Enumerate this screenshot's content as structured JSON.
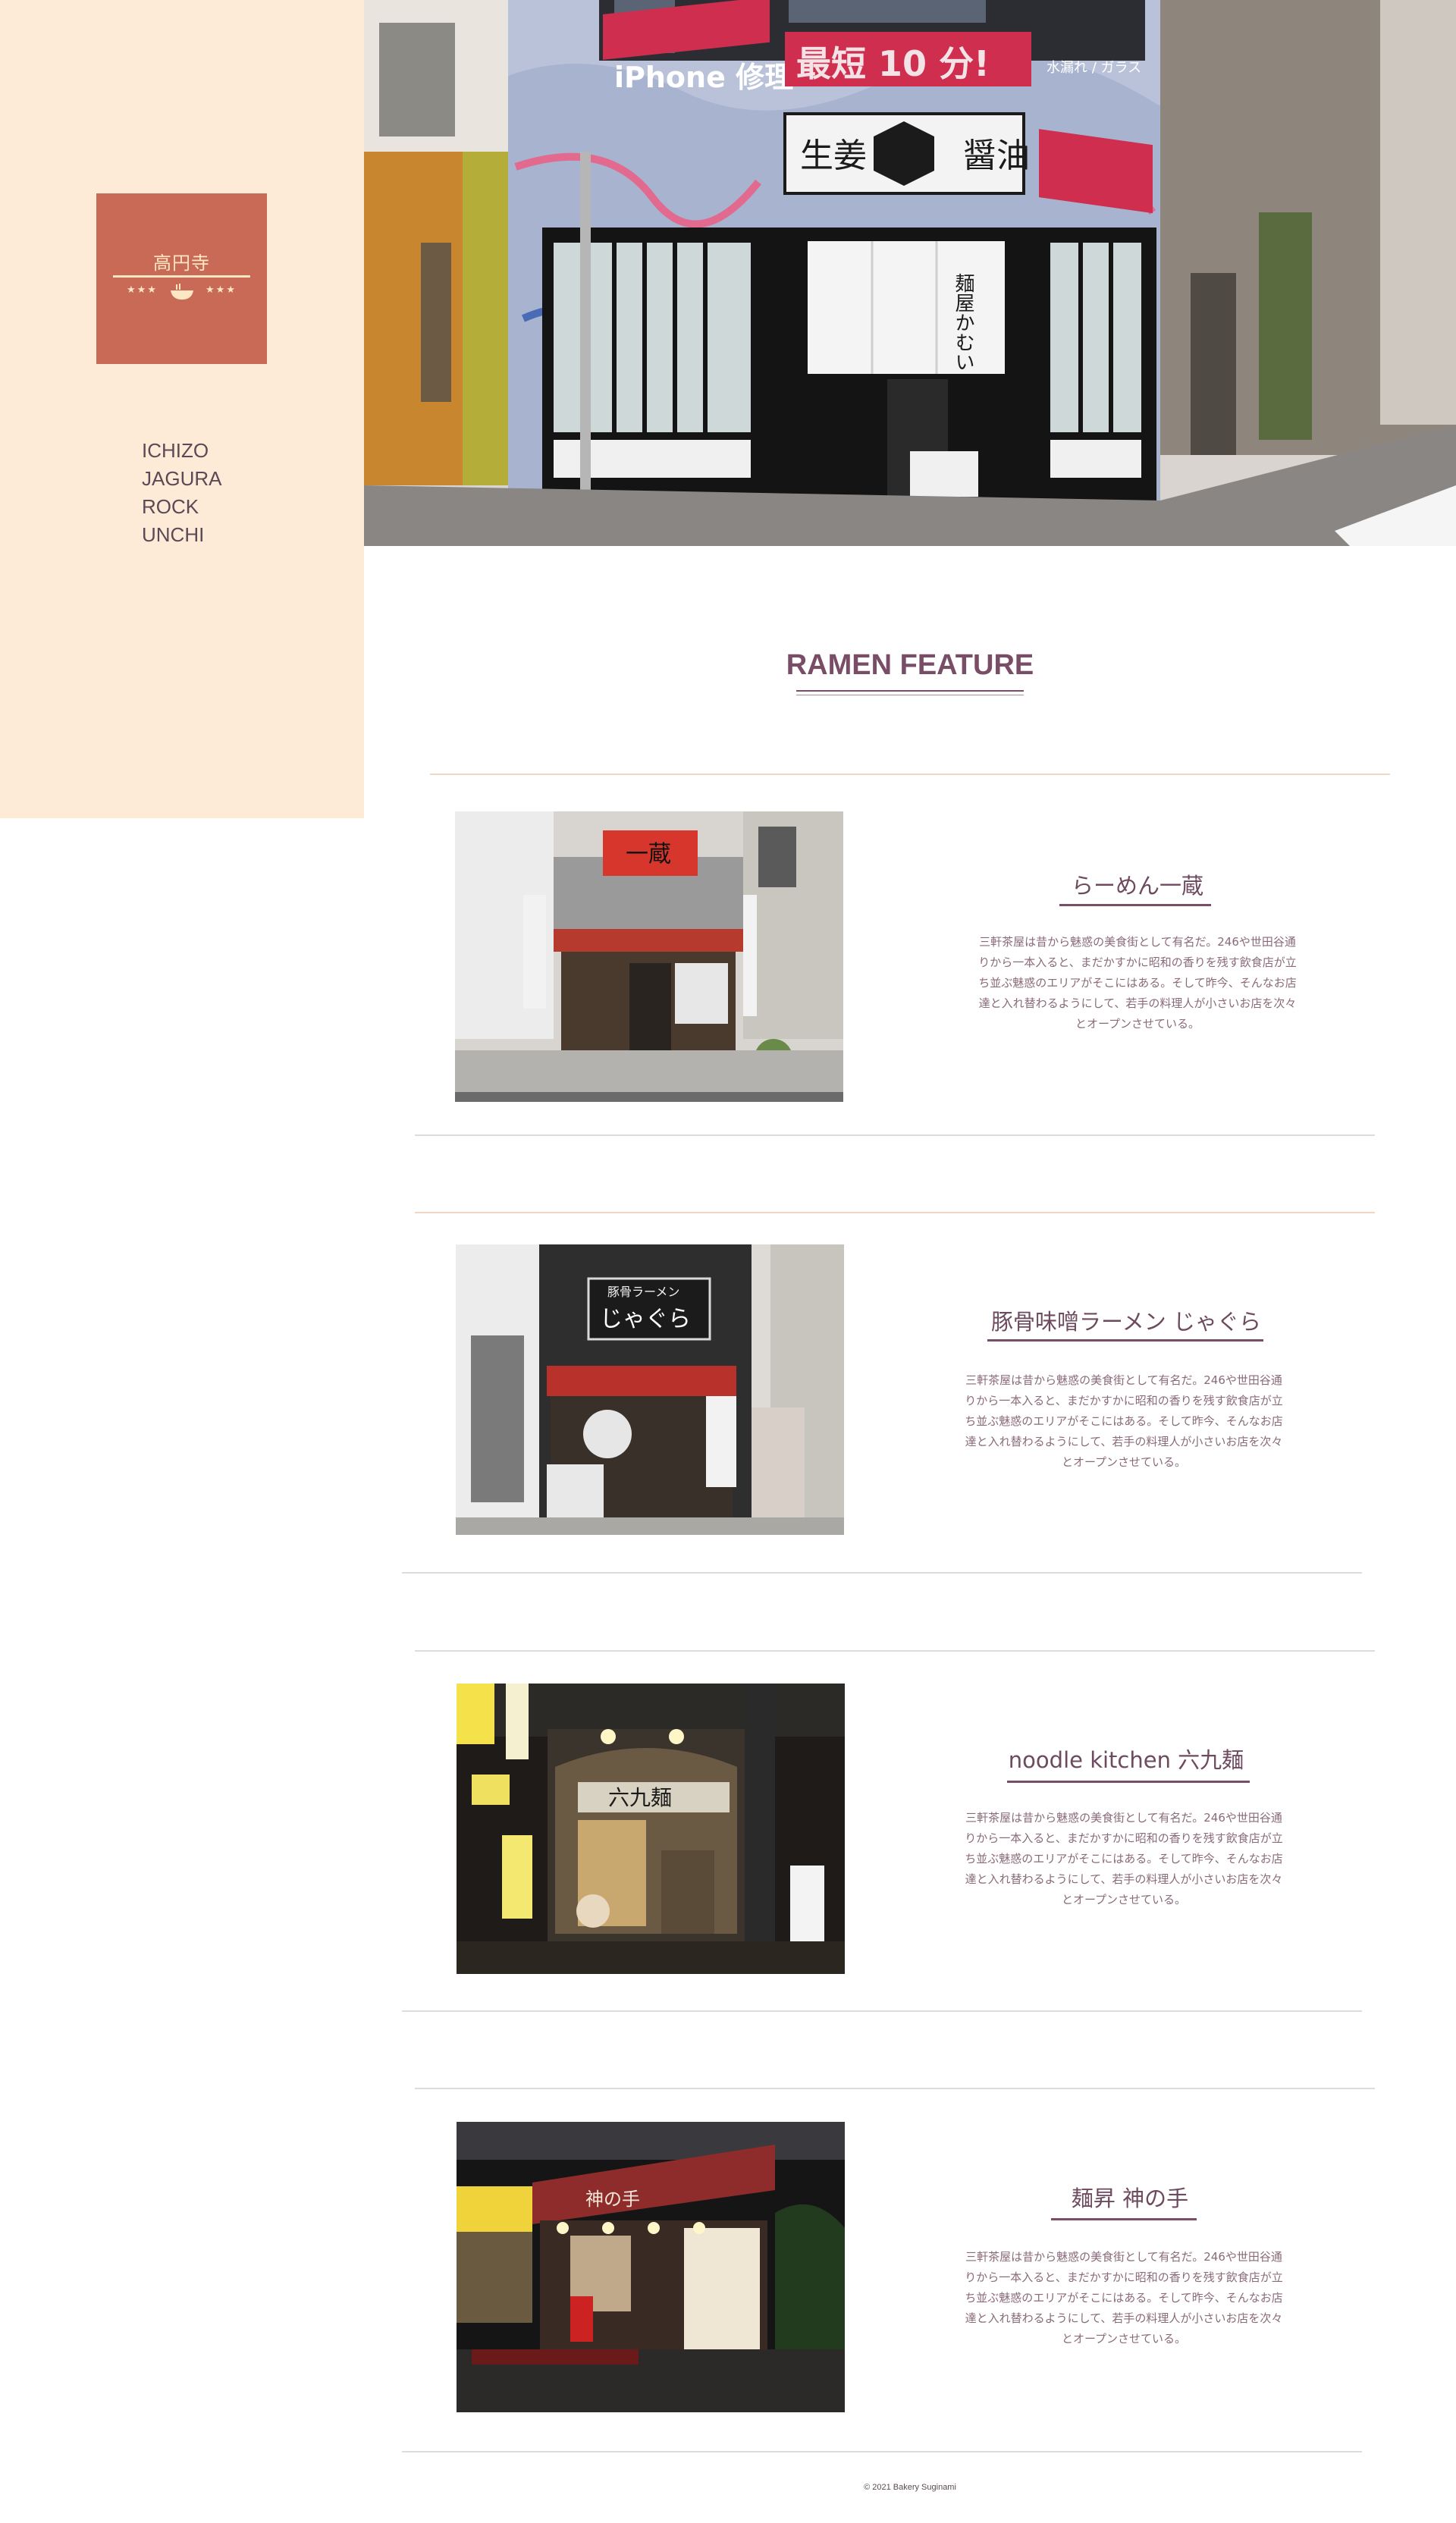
{
  "sidebar": {
    "logo": {
      "title": "高円寺",
      "stars_left": "★★★",
      "stars_right": "★★★",
      "icon": "ramen-bowl-icon"
    },
    "nav": [
      {
        "label": "ICHIZO"
      },
      {
        "label": "JAGURA"
      },
      {
        "label": "ROCK"
      },
      {
        "label": "UNCHI"
      }
    ]
  },
  "hero": {
    "signs": {
      "repair": "iPhone 修理",
      "fastest": "最短 10 分!",
      "shop_board_left": "生姜",
      "shop_board_center": "麺屋\nかむい",
      "shop_board_right": "醤油",
      "noren": "麺屋かむい",
      "side_sign": "水漏れ / ガラス"
    }
  },
  "section": {
    "title": "RAMEN FEATURE"
  },
  "features": [
    {
      "name": "らーめん一蔵",
      "desc": [
        "三軒茶屋は昔から魅惑の美食街として有名だ。246や世田谷通",
        "りから一本入ると、まだかすかに昭和の香りを残す飲食店が立",
        "ち並ぶ魅惑のエリアがそこにはある。そして昨今、そんなお店",
        "達と入れ替わるようにして、若手の料理人が小さいお店を次々",
        "とオープンさせている。"
      ],
      "sign": "一蔵"
    },
    {
      "name": "豚骨味噌ラーメン じゃぐら",
      "desc": [
        "三軒茶屋は昔から魅惑の美食街として有名だ。246や世田谷通",
        "りから一本入ると、まだかすかに昭和の香りを残す飲食店が立",
        "ち並ぶ魅惑のエリアがそこにはある。そして昨今、そんなお店",
        "達と入れ替わるようにして、若手の料理人が小さいお店を次々",
        "とオープンさせている。"
      ],
      "sign_top": "豚骨ラーメン",
      "sign": "じゃぐら"
    },
    {
      "name": "noodle kitchen 六九麺",
      "desc": [
        "三軒茶屋は昔から魅惑の美食街として有名だ。246や世田谷通",
        "りから一本入ると、まだかすかに昭和の香りを残す飲食店が立",
        "ち並ぶ魅惑のエリアがそこにはある。そして昨今、そんなお店",
        "達と入れ替わるようにして、若手の料理人が小さいお店を次々",
        "とオープンさせている。"
      ],
      "sign": "六九麺"
    },
    {
      "name": "麺昇 神の手",
      "desc": [
        "三軒茶屋は昔から魅惑の美食街として有名だ。246や世田谷通",
        "りから一本入ると、まだかすかに昭和の香りを残す飲食店が立",
        "ち並ぶ魅惑のエリアがそこにはある。そして昨今、そんなお店",
        "達と入れ替わるようにして、若手の料理人が小さいお店を次々",
        "とオープンさせている。"
      ],
      "sign": "神の手"
    }
  ],
  "footer": {
    "text": "© 2021 Bakery Suginami"
  },
  "colors": {
    "sidebar_bg": "#fdebd8",
    "logo_bg": "#c96a57",
    "accent": "#7a4d66"
  }
}
